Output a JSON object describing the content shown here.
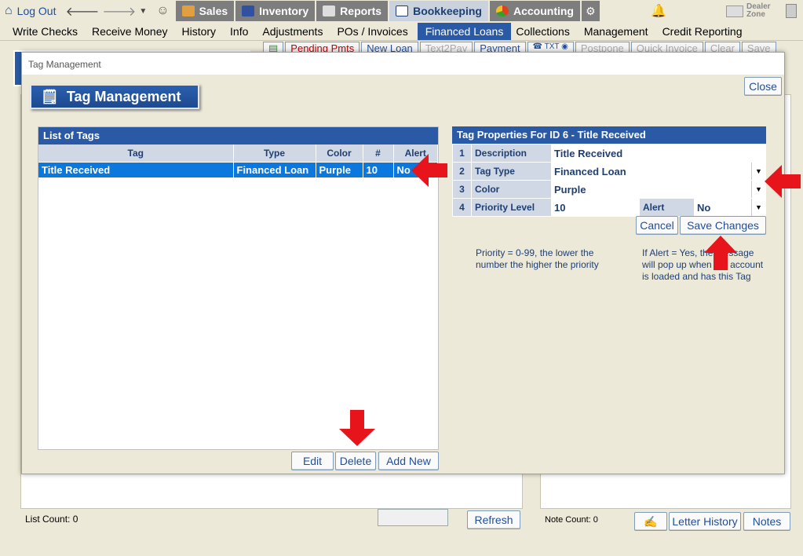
{
  "topbar": {
    "logout": "Log Out",
    "tabs": [
      {
        "label": "Sales",
        "icon": "salesperson-icon",
        "color": "#e0a040"
      },
      {
        "label": "Inventory",
        "icon": "car-icon",
        "color": "#3050a0"
      },
      {
        "label": "Reports",
        "icon": "report-icon",
        "color": "#dddddd"
      },
      {
        "label": "Bookkeeping",
        "icon": "book-icon",
        "color": "#ffffff"
      },
      {
        "label": "Accounting",
        "icon": "pie-chart-icon",
        "color": "#e04020"
      }
    ],
    "dealer_zone": "Dealer Zone"
  },
  "menu": [
    "Write Checks",
    "Receive Money",
    "History",
    "Info",
    "Adjustments",
    "POs / Invoices",
    "Financed Loans",
    "Collections",
    "Management",
    "Credit Reporting"
  ],
  "toolbar": [
    "Pending Pmts",
    "New Loan",
    "Text2Pay",
    "Payment",
    "Postpone",
    "Quick Invoice",
    "Clear",
    "Save"
  ],
  "background": {
    "list_count": "List Count: 0",
    "refresh": "Refresh",
    "note_count": "Note Count: 0",
    "letter_history": "Letter History",
    "notes": "Notes"
  },
  "modal": {
    "title": "Tag Management",
    "header": "Tag Management",
    "close": "Close",
    "list_title": "List of Tags",
    "columns": [
      "Tag",
      "Type",
      "Color",
      "#",
      "Alert"
    ],
    "rows": [
      {
        "tag": "Title Received",
        "type": "Financed Loan",
        "color": "Purple",
        "num": "10",
        "alert": "No"
      }
    ],
    "buttons": {
      "edit": "Edit",
      "delete": "Delete",
      "add_new": "Add New",
      "cancel": "Cancel",
      "save": "Save Changes"
    },
    "props_title": "Tag Properties For ID 6 - Title Received",
    "props": {
      "description_label": "Description",
      "description_value": "Title Received",
      "tag_type_label": "Tag Type",
      "tag_type_value": "Financed Loan",
      "color_label": "Color",
      "color_value": "Purple",
      "priority_label": "Priority Level",
      "priority_value": "10",
      "alert_label": "Alert",
      "alert_value": "No"
    },
    "note_priority": "Priority = 0-99, the lower the number the higher the priority",
    "note_alert": "If Alert = Yes, the message will pop up when the account is loaded and has this Tag"
  }
}
